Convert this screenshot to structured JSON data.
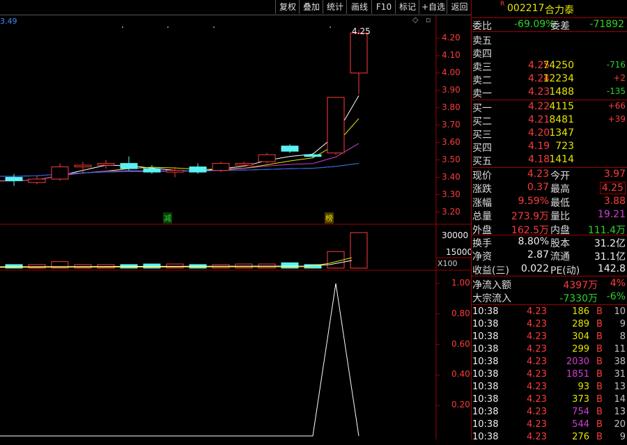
{
  "toolbar": {
    "buttons": [
      "复权",
      "叠加",
      "统计",
      "画线",
      "F10",
      "标记",
      "+自选",
      "返回"
    ]
  },
  "chart": {
    "top_left_value": "3.49",
    "last_price_label": "4.25",
    "price_ticks": [
      "4.20",
      "4.10",
      "4.00",
      "3.90",
      "3.80",
      "3.70",
      "3.60",
      "3.50",
      "3.40",
      "3.30",
      "3.20"
    ],
    "marker_jian": "减",
    "marker_bang": "榜",
    "volume_ticks": [
      "30000",
      "15000"
    ],
    "volume_unit": "X100",
    "indicator_ticks": [
      "1.00",
      "0.80",
      "0.60",
      "0.40",
      "0.20"
    ]
  },
  "chart_data": {
    "type": "candlestick",
    "candles": [
      {
        "open": 3.4,
        "close": 3.38,
        "high": 3.42,
        "low": 3.35
      },
      {
        "open": 3.37,
        "close": 3.39,
        "high": 3.41,
        "low": 3.36
      },
      {
        "open": 3.39,
        "close": 3.46,
        "high": 3.48,
        "low": 3.38
      },
      {
        "open": 3.46,
        "close": 3.47,
        "high": 3.49,
        "low": 3.42
      },
      {
        "open": 3.47,
        "close": 3.48,
        "high": 3.5,
        "low": 3.45
      },
      {
        "open": 3.48,
        "close": 3.45,
        "high": 3.52,
        "low": 3.44
      },
      {
        "open": 3.45,
        "close": 3.43,
        "high": 3.47,
        "low": 3.42
      },
      {
        "open": 3.43,
        "close": 3.44,
        "high": 3.46,
        "low": 3.4
      },
      {
        "open": 3.46,
        "close": 3.43,
        "high": 3.48,
        "low": 3.42
      },
      {
        "open": 3.44,
        "close": 3.48,
        "high": 3.49,
        "low": 3.43
      },
      {
        "open": 3.47,
        "close": 3.48,
        "high": 3.49,
        "low": 3.46
      },
      {
        "open": 3.49,
        "close": 3.53,
        "high": 3.54,
        "low": 3.48
      },
      {
        "open": 3.58,
        "close": 3.55,
        "high": 3.59,
        "low": 3.54
      },
      {
        "open": 3.53,
        "close": 3.52,
        "high": 3.54,
        "low": 3.51
      },
      {
        "open": 3.54,
        "close": 3.86,
        "high": 3.86,
        "low": 3.53
      },
      {
        "open": 4.0,
        "close": 4.23,
        "high": 4.25,
        "low": 3.88
      }
    ],
    "volume": [
      60,
      60,
      110,
      60,
      60,
      60,
      70,
      70,
      60,
      60,
      70,
      70,
      90,
      60,
      280,
      600
    ],
    "volume_max": 30000,
    "indicator": [
      0,
      0,
      0,
      0,
      0,
      0,
      0,
      0,
      0,
      0,
      0,
      0,
      0,
      0,
      1.0,
      0
    ],
    "price_range": [
      3.15,
      4.3
    ]
  },
  "stock": {
    "flag": "R",
    "code": "002217",
    "name": "合力泰"
  },
  "book": {
    "weibi_label": "委比",
    "weibi_value": "-69.09%",
    "weicha_label": "委差",
    "weicha_value": "-71892",
    "asks": [
      {
        "label": "卖五",
        "price": "",
        "vol": "",
        "chg": ""
      },
      {
        "label": "卖四",
        "price": "",
        "vol": "",
        "chg": ""
      },
      {
        "label": "卖三",
        "price": "4.25",
        "vol": "74250",
        "chg": "-716"
      },
      {
        "label": "卖二",
        "price": "4.24",
        "vol": "12234",
        "chg": "+2"
      },
      {
        "label": "卖一",
        "price": "4.23",
        "vol": "1488",
        "chg": "-135"
      }
    ],
    "bids": [
      {
        "label": "买一",
        "price": "4.22",
        "vol": "4115",
        "chg": "+66"
      },
      {
        "label": "买二",
        "price": "4.21",
        "vol": "8481",
        "chg": "+39"
      },
      {
        "label": "买三",
        "price": "4.20",
        "vol": "1347",
        "chg": ""
      },
      {
        "label": "买四",
        "price": "4.19",
        "vol": "723",
        "chg": ""
      },
      {
        "label": "买五",
        "price": "4.18",
        "vol": "1414",
        "chg": ""
      }
    ]
  },
  "quote": [
    {
      "l1": "现价",
      "v1": "4.23",
      "l2": "今开",
      "v2": "3.97"
    },
    {
      "l1": "涨跌",
      "v1": "0.37",
      "l2": "最高",
      "v2": "4.25"
    },
    {
      "l1": "涨幅",
      "v1": "9.59%",
      "l2": "最低",
      "v2": "3.88"
    },
    {
      "l1": "总量",
      "v1": "273.9万",
      "l2": "量比",
      "v2": "19.21"
    },
    {
      "l1": "外盘",
      "v1": "162.5万",
      "l2": "内盘",
      "v2": "111.4万"
    }
  ],
  "stats": [
    {
      "l1": "换手",
      "v1": "8.80%",
      "l2": "股本",
      "v2": "31.2亿"
    },
    {
      "l1": "净资",
      "v1": "2.87",
      "l2": "流通",
      "v2": "31.1亿"
    },
    {
      "l1": "收益(三)",
      "v1": "0.022",
      "l2": "PE(动)",
      "v2": "142.8"
    }
  ],
  "flow": [
    {
      "label": "净流入额",
      "value": "4397万",
      "pct": "4%"
    },
    {
      "label": "大宗流入",
      "value": "-7330万",
      "pct": "-6%"
    }
  ],
  "ticks": [
    {
      "time": "10:38",
      "price": "4.23",
      "vol": "186",
      "side": "B",
      "n": "10"
    },
    {
      "time": "10:38",
      "price": "4.23",
      "vol": "289",
      "side": "B",
      "n": "9"
    },
    {
      "time": "10:38",
      "price": "4.23",
      "vol": "304",
      "side": "B",
      "n": "8"
    },
    {
      "time": "10:38",
      "price": "4.23",
      "vol": "299",
      "side": "B",
      "n": "11"
    },
    {
      "time": "10:38",
      "price": "4.23",
      "vol": "2030",
      "side": "B",
      "n": "38"
    },
    {
      "time": "10:38",
      "price": "4.23",
      "vol": "1851",
      "side": "B",
      "n": "31"
    },
    {
      "time": "10:38",
      "price": "4.23",
      "vol": "93",
      "side": "B",
      "n": "13"
    },
    {
      "time": "10:38",
      "price": "4.23",
      "vol": "373",
      "side": "B",
      "n": "14"
    },
    {
      "time": "10:38",
      "price": "4.23",
      "vol": "754",
      "side": "B",
      "n": "13"
    },
    {
      "time": "10:38",
      "price": "4.23",
      "vol": "544",
      "side": "B",
      "n": "20"
    },
    {
      "time": "10:38",
      "price": "4.23",
      "vol": "276",
      "side": "B",
      "n": "9"
    }
  ],
  "colors": {
    "up": "#ff3b3b",
    "down": "#2bd42b",
    "bg": "#000000",
    "border": "#a00000",
    "cyan": "#5cf2f2",
    "yellow": "#e6e600",
    "purple": "#d040d0"
  }
}
